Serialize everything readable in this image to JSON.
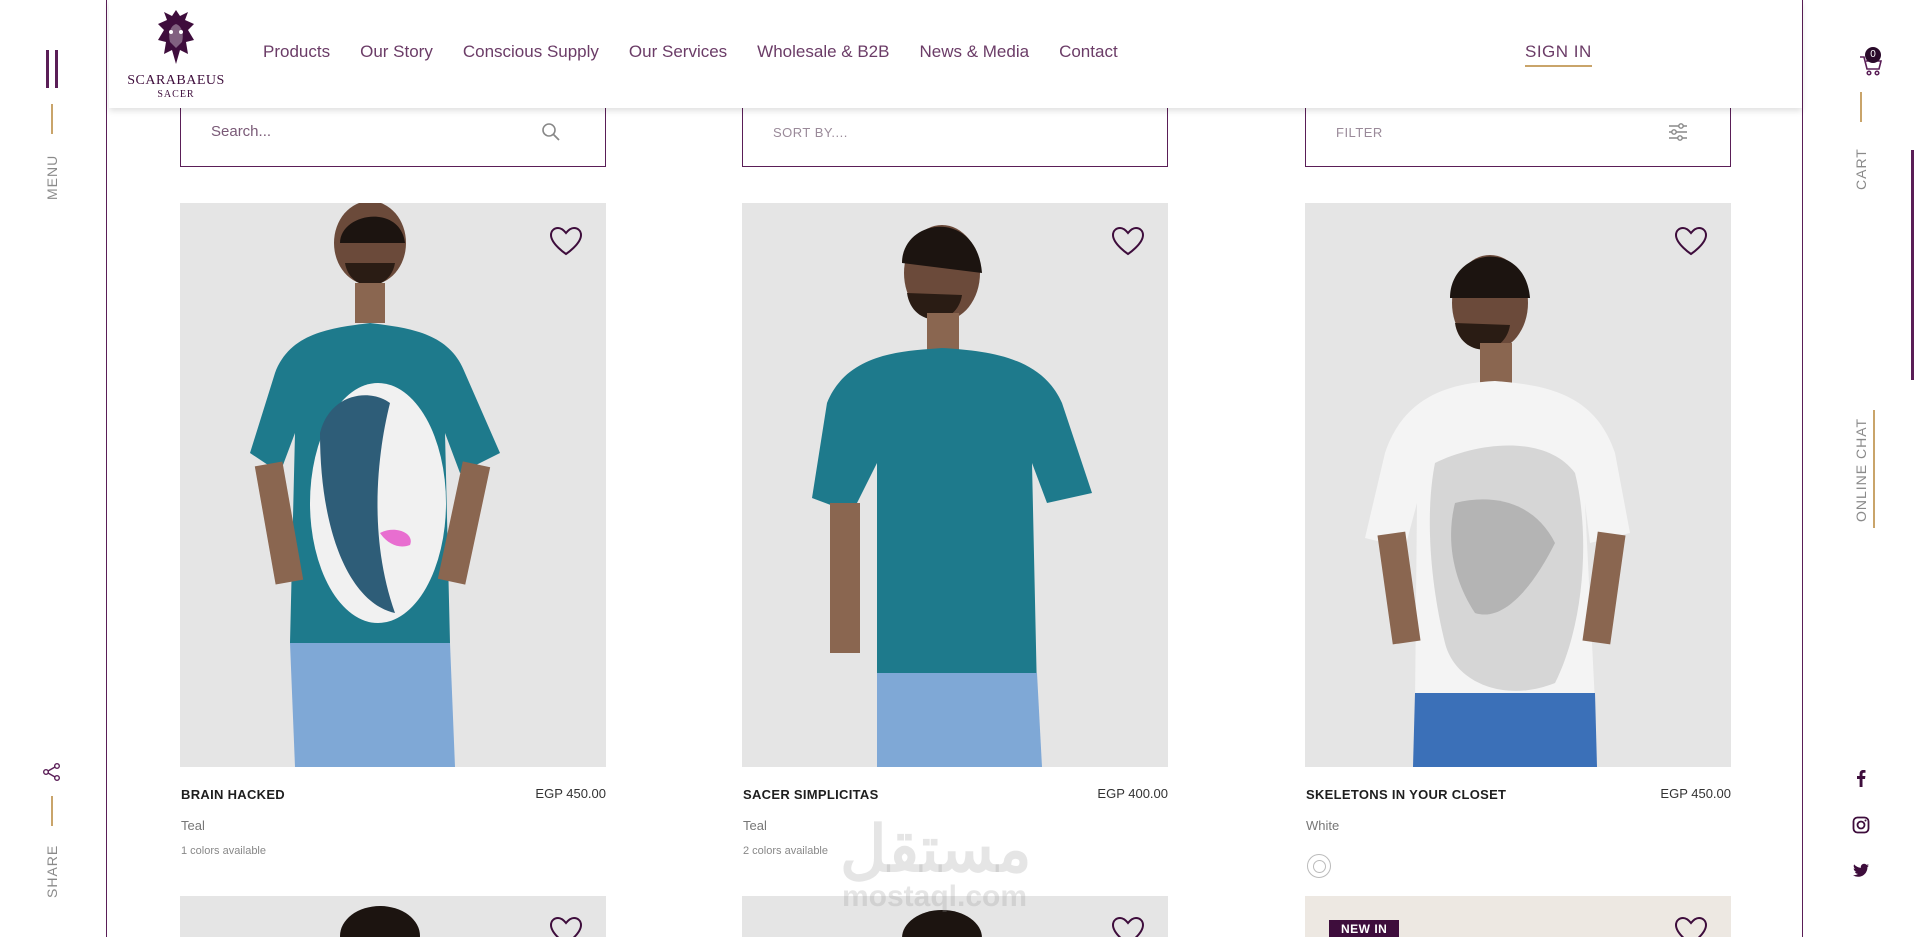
{
  "left_rail": {
    "menu_label": "MENU",
    "share_label": "SHARE"
  },
  "right_rail": {
    "cart_label": "CART",
    "cart_count": "0",
    "chat_label": "ONLINE CHAT"
  },
  "brand": {
    "name": "SCARABAEUS",
    "sub": "SACER"
  },
  "nav": [
    "Products",
    "Our Story",
    "Conscious Supply",
    "Our Services",
    "Wholesale & B2B",
    "News & Media",
    "Contact"
  ],
  "signin_label": "SIGN IN",
  "controls": {
    "search_placeholder": "Search...",
    "sort_label": "SORT BY....",
    "filter_label": "FILTER"
  },
  "products": [
    {
      "name": "BRAIN HACKED",
      "price": "EGP 450.00",
      "color": "Teal",
      "availability": "1 colors available"
    },
    {
      "name": "SACER SIMPLICITAS",
      "price": "EGP 400.00",
      "color": "Teal",
      "availability": "2 colors available"
    },
    {
      "name": "SKELETONS IN YOUR CLOSET",
      "price": "EGP 450.00",
      "color": "White",
      "availability": ""
    }
  ],
  "new_badge": "NEW IN",
  "watermark": {
    "arabic": "مستقل",
    "latin": "mostaql.com"
  },
  "colors": {
    "brand_purple": "#5a1e57",
    "accent_gold": "#c9a46a",
    "image_bg": "#e5e5e5"
  }
}
